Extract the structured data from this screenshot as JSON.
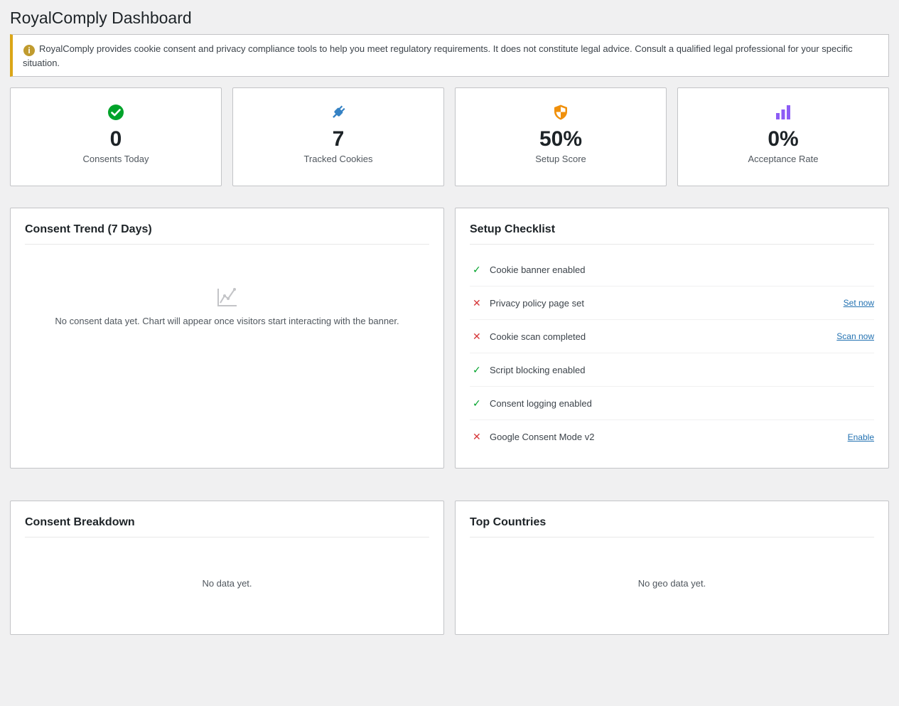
{
  "page": {
    "title": "RoyalComply Dashboard"
  },
  "notice": {
    "icon": "info-icon",
    "icon_glyph": "i",
    "text": "RoyalComply provides cookie consent and privacy compliance tools to help you meet regulatory requirements. It does not constitute legal advice. Consult a qualified legal professional for your specific situation.",
    "accent_color": "#dba617"
  },
  "stats": [
    {
      "icon": "check-circle-icon",
      "value": "0",
      "label": "Consents Today",
      "color": "#00a32a"
    },
    {
      "icon": "plug-icon",
      "value": "7",
      "label": "Tracked Cookies",
      "color": "#3582c4"
    },
    {
      "icon": "shield-icon",
      "value": "50%",
      "label": "Setup Score",
      "color": "#f0900b"
    },
    {
      "icon": "bar-chart-icon",
      "value": "0%",
      "label": "Acceptance Rate",
      "color": "#8c5cf5"
    }
  ],
  "trend": {
    "title": "Consent Trend (7 Days)",
    "empty_icon": "chart-line-icon",
    "empty_text": "No consent data yet. Chart will appear once visitors start interacting with the banner."
  },
  "checklist": {
    "title": "Setup Checklist",
    "items": [
      {
        "label": "Cookie banner enabled",
        "done": true,
        "mark": "✓",
        "link": ""
      },
      {
        "label": "Privacy policy page set",
        "done": false,
        "mark": "✕",
        "link": "Set now"
      },
      {
        "label": "Cookie scan completed",
        "done": false,
        "mark": "✕",
        "link": "Scan now"
      },
      {
        "label": "Script blocking enabled",
        "done": true,
        "mark": "✓",
        "link": ""
      },
      {
        "label": "Consent logging enabled",
        "done": true,
        "mark": "✓",
        "link": ""
      },
      {
        "label": "Google Consent Mode v2",
        "done": false,
        "mark": "✕",
        "link": "Enable"
      }
    ]
  },
  "breakdown": {
    "title": "Consent Breakdown",
    "empty_text": "No data yet."
  },
  "countries": {
    "title": "Top Countries",
    "empty_text": "No geo data yet."
  }
}
